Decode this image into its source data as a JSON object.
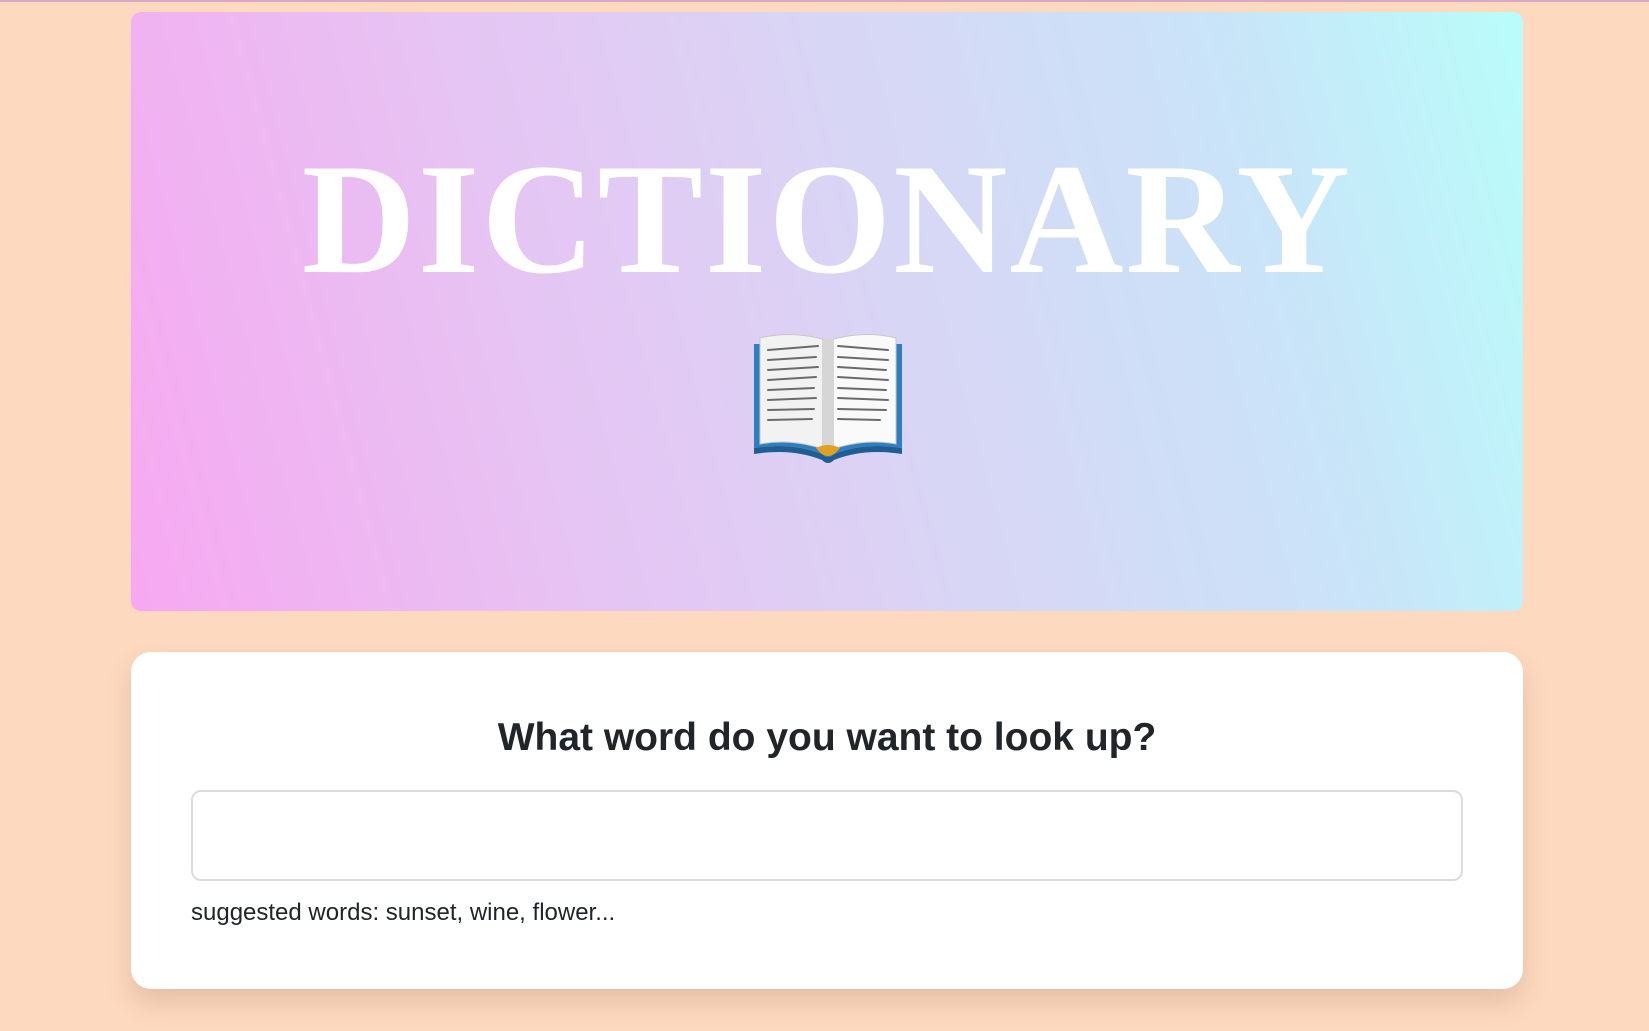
{
  "hero": {
    "title": "DICTIONARY",
    "icon": "open-book-icon",
    "gradient_start": "#f7a8f1",
    "gradient_end": "#b9fdfb"
  },
  "search": {
    "heading": "What word do you want to look up?",
    "value": "",
    "placeholder": "",
    "hint": "suggested words: sunset, wine, flower..."
  },
  "colors": {
    "page_background": "#fdd9bf",
    "card_background": "#ffffff",
    "heading_text": "#212529"
  }
}
